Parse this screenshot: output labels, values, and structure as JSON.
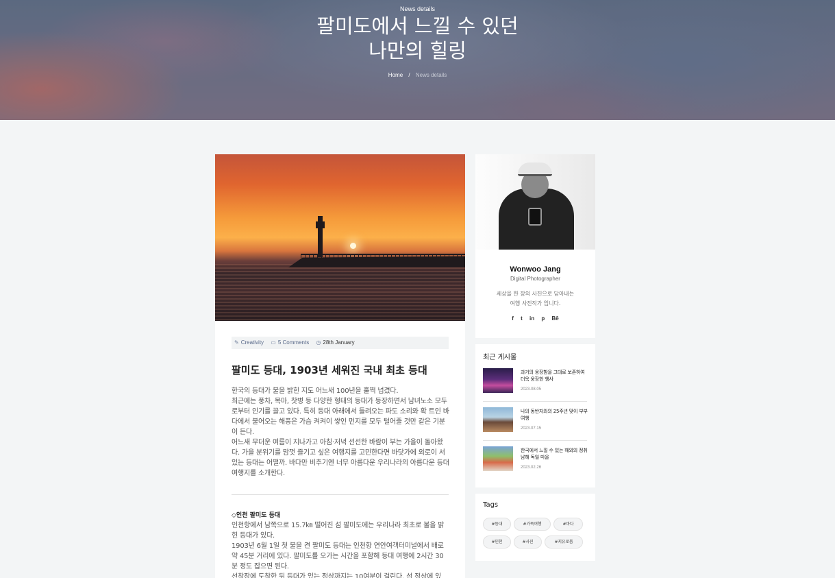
{
  "hero": {
    "kicker": "News details",
    "title_line1": "팔미도에서 느낄 수 있던",
    "title_line2": "나만의 힐링",
    "breadcrumb_home": "Home",
    "breadcrumb_sep": "/",
    "breadcrumb_current": "News details"
  },
  "article": {
    "meta": {
      "category": "Creativity",
      "comments": "5 Comments",
      "date": "28th January"
    },
    "title": "팔미도 등대, 1903년 세워진 국내 최초 등대",
    "body": [
      "한국의 등대가 불을 밝힌 지도 어느새 100년을 훌쩍 넘겼다.",
      "최근에는 풍차, 목마, 찻병 등 다양한 형태의 등대가 등장하면서 남녀노소 모두로부터 인기를 끌고 있다. 특히 등대 아래에서 들려오는 파도 소리와 확 트인 바다에서 불어오는 해풍은 가슴 켜켜이 쌓인 먼지를 모두 털어줄 것만 같은 기분이 든다.",
      "어느새 무더운 여름이 지나가고 아침·저녁 선선한 바람이 부는 가을이 돌아왔다. 가을 분위기를 맘껏 즐기고 싶은 여행지를 고민한다면 바닷가에 외로이 서 있는 등대는 어떨까. 바다만 비추기엔 너무 아름다운 우리나라의 아름다운 등대 여행지를 소개한다."
    ],
    "section_heading": "◇인천 팔미도 등대",
    "section_body": [
      "인천항에서 남쪽으로 15.7㎞ 떨어진 섬 팔미도에는 우리나라 최초로 불을 밝힌 등대가 있다.",
      "1903년 6월 1일 첫 불을 켠 팔미도 등대는 인천항 연안여객터미널에서 배로 약 45분 거리에 있다. 팔미도를 오가는 시간을 포함해 등대 여행에 2시간 30분 정도 잡으면 된다.",
      "선착장에 도착한 뒤 등대가 있는 정상까지는 10여분이 걸린다. 섬 정상에 있"
    ]
  },
  "profile": {
    "name": "Wonwoo Jang",
    "role": "Digital Photographer",
    "bio_line1": "세상을 한 장의 사진으로 담아내는",
    "bio_line2": "여행 사진작가 입니다.",
    "social": [
      "f",
      "t",
      "in",
      "p",
      "Bē"
    ]
  },
  "recent": {
    "title": "최근 게시물",
    "posts": [
      {
        "title": "과거의 웅장함을 그대로 보존하여 더욱 웅장한 행사",
        "date": "2023.08.05"
      },
      {
        "title": "나의 동반자와의 25주년 맞이 부부여행",
        "date": "2023.07.15"
      },
      {
        "title": "한국에서 느낄 수 있는 해외의 정취 남해 독일 마을",
        "date": "2023.02.26"
      }
    ]
  },
  "tags": {
    "title": "Tags",
    "items": [
      "#등대",
      "#가족여행",
      "#바다",
      "#인천",
      "#사진",
      "#지유로움"
    ]
  },
  "colors": {
    "page_bg": "#f3f5f6",
    "meta_text": "#5a6a8a",
    "card_bg": "#ffffff"
  }
}
